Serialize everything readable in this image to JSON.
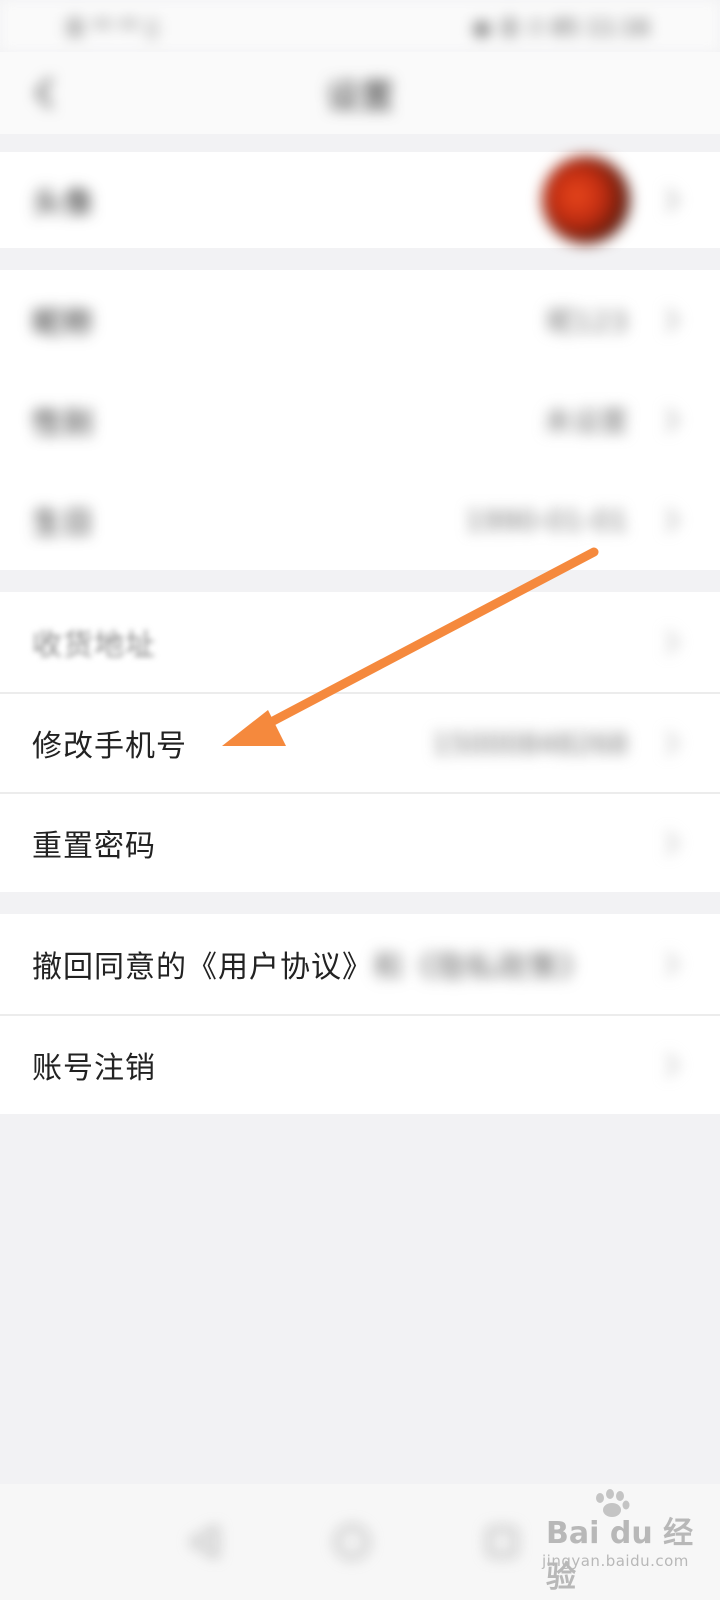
{
  "status_bar": {
    "left_text": "全 ⁴ᴳ ⁴ᴳ ▯",
    "right_text": "◉ 全 ⏱ 85 11:16"
  },
  "header": {
    "title": "设置",
    "back_icon": "chevron-left-icon"
  },
  "profile_card": {
    "avatar_label": "头像"
  },
  "info_card": {
    "items": [
      {
        "label": "昵称",
        "value": "昵123"
      },
      {
        "label": "性别",
        "value": "未设置"
      },
      {
        "label": "生日",
        "value": "1990-01-01"
      }
    ]
  },
  "account_card": {
    "items": [
      {
        "label": "收货地址",
        "value": ""
      },
      {
        "label": "修改手机号",
        "value": "15000848268"
      },
      {
        "label": "重置密码",
        "value": ""
      }
    ]
  },
  "privacy_card": {
    "items": [
      {
        "label_clear": "撤回同意的《用户协议》",
        "label_blurred": "和《隐私政策》"
      },
      {
        "label": "账号注销"
      }
    ]
  },
  "bottom_nav": {
    "icons": [
      "back-triangle-icon",
      "home-circle-icon",
      "recent-square-icon"
    ]
  },
  "watermark": {
    "logo_text": "Bai du 经验",
    "url_text": "jingyan.baidu.com"
  },
  "colors": {
    "background": "#f2f2f4",
    "card": "#ffffff",
    "arrow": "#f5893d"
  }
}
